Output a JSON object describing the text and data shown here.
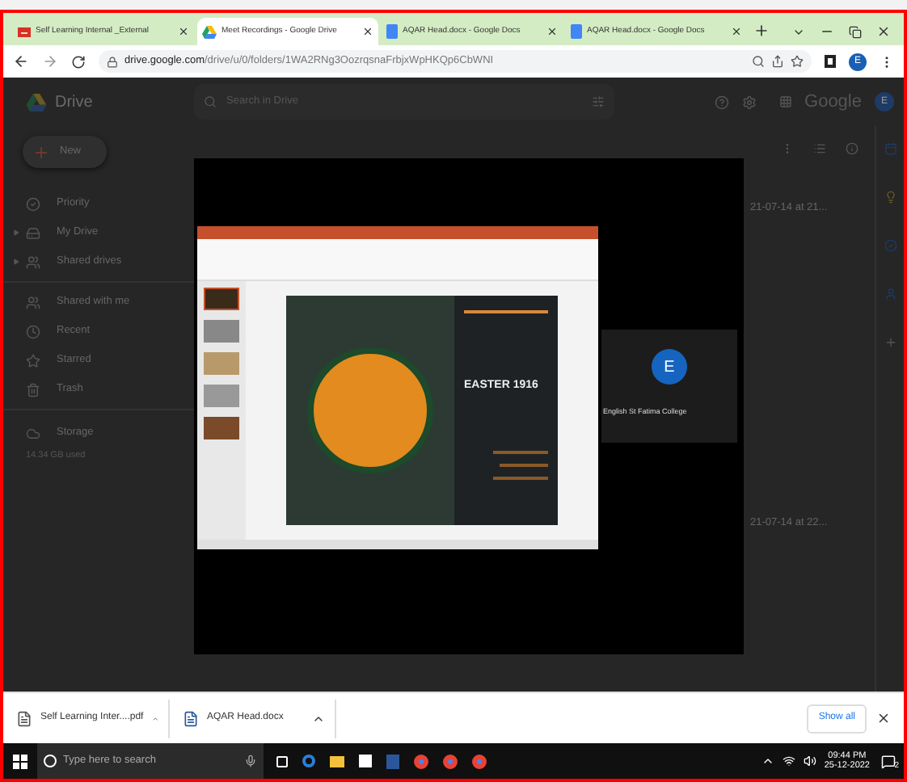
{
  "tabs": [
    {
      "label": "Self Learning Internal _External",
      "kind": "gmail",
      "selected": false
    },
    {
      "label": "Meet Recordings - Google Drive",
      "kind": "drive",
      "selected": true
    },
    {
      "label": "AQAR Head.docx - Google Docs",
      "kind": "docs",
      "selected": false
    },
    {
      "label": "AQAR Head.docx - Google Docs",
      "kind": "docs",
      "selected": false
    }
  ],
  "address_bar": {
    "domain": "drive.google.com",
    "path": "/drive/u/0/folders/1WA2RNg3OozrqsnaFrbjxWpHKQp6CbWNI",
    "avatar": "E"
  },
  "drive": {
    "logo": "Drive",
    "search": {
      "placeholder": "Search in Drive"
    },
    "brand": "Google",
    "avatar": "E",
    "new_button": "New",
    "nav_groups": [
      {
        "items": [
          {
            "label": "Priority",
            "kind": "link"
          },
          {
            "label": "My Drive",
            "kind": "tree"
          },
          {
            "label": "Shared drives",
            "kind": "tree"
          }
        ]
      },
      {
        "items": [
          {
            "label": "Shared with me",
            "kind": "link"
          },
          {
            "label": "Recent",
            "kind": "link"
          },
          {
            "label": "Starred",
            "kind": "link"
          },
          {
            "label": "Trash",
            "kind": "link"
          }
        ]
      }
    ],
    "storage": {
      "label": "Storage",
      "usage": "14.34 GB used"
    },
    "files": [
      {
        "name": "21-07-14 at 21..."
      },
      {
        "name": "21-07-14 at 22..."
      }
    ]
  },
  "video": {
    "slide": {
      "title": "EASTER 1916"
    },
    "participant": {
      "initial": "E",
      "name": "English St Fatima College"
    }
  },
  "downloads": {
    "items": [
      {
        "name": "Self Learning Inter....pdf",
        "kind": "pdf"
      },
      {
        "name": "AQAR Head.docx",
        "kind": "docx"
      }
    ],
    "show_all": "Show all"
  },
  "taskbar": {
    "search_placeholder": "Type here to search",
    "time": "09:44 PM",
    "date": "25-12-2022",
    "notifications": "2"
  }
}
